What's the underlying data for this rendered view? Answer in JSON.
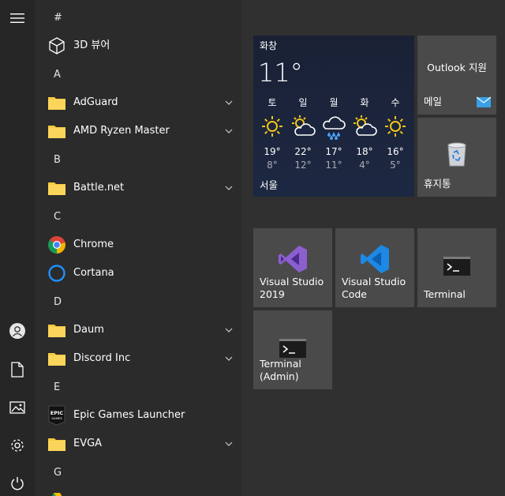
{
  "rail": {
    "icons": [
      "hamburger-menu-icon",
      "user-account-icon",
      "documents-icon",
      "pictures-icon",
      "settings-icon",
      "power-icon"
    ]
  },
  "app_list": {
    "headers": {
      "hash": "#",
      "a": "A",
      "b": "B",
      "c": "C",
      "d": "D",
      "e": "E",
      "g": "G"
    },
    "apps": {
      "viewer3d": "3D 뷰어",
      "adguard": "AdGuard",
      "amd": "AMD Ryzen Master",
      "battlenet": "Battle.net",
      "chrome": "Chrome",
      "cortana": "Cortana",
      "daum": "Daum",
      "discord": "Discord Inc",
      "epic": "Epic Games Launcher",
      "evga": "EVGA"
    },
    "epic_logo_text": "EPIC GAMES"
  },
  "weather": {
    "city_label": "화창",
    "current_temp": "11°",
    "location": "서울",
    "forecast": [
      {
        "day": "토",
        "icon": "sun-icon",
        "high": "19°",
        "low": "8°"
      },
      {
        "day": "일",
        "icon": "partly-cloudy-icon",
        "high": "22°",
        "low": "12°"
      },
      {
        "day": "월",
        "icon": "rain-icon",
        "high": "17°",
        "low": "11°"
      },
      {
        "day": "화",
        "icon": "partly-cloudy-icon",
        "high": "18°",
        "low": "4°"
      },
      {
        "day": "수",
        "icon": "sun-icon",
        "high": "16°",
        "low": "5°"
      }
    ]
  },
  "tiles": {
    "outlook": {
      "title": "Outlook 지원",
      "label": "메일"
    },
    "recycle": {
      "label": "휴지통"
    },
    "vs2019": {
      "label_line1": "Visual Studio",
      "label_line2": "2019"
    },
    "vscode": {
      "label_line1": "Visual Studio",
      "label_line2": "Code"
    },
    "terminal": {
      "label": "Terminal"
    },
    "terminal_admin": {
      "label_line1": "Terminal",
      "label_line2": "(Admin)"
    }
  },
  "colors": {
    "tile": "#4a4a4a",
    "weather_tile": "#1c2842",
    "folder": "#f8c942",
    "mail_accent": "#3aa0e6",
    "vs_purple": "#8b5fd0",
    "vscode_blue": "#1e88e5",
    "sun": "#f5c518"
  }
}
